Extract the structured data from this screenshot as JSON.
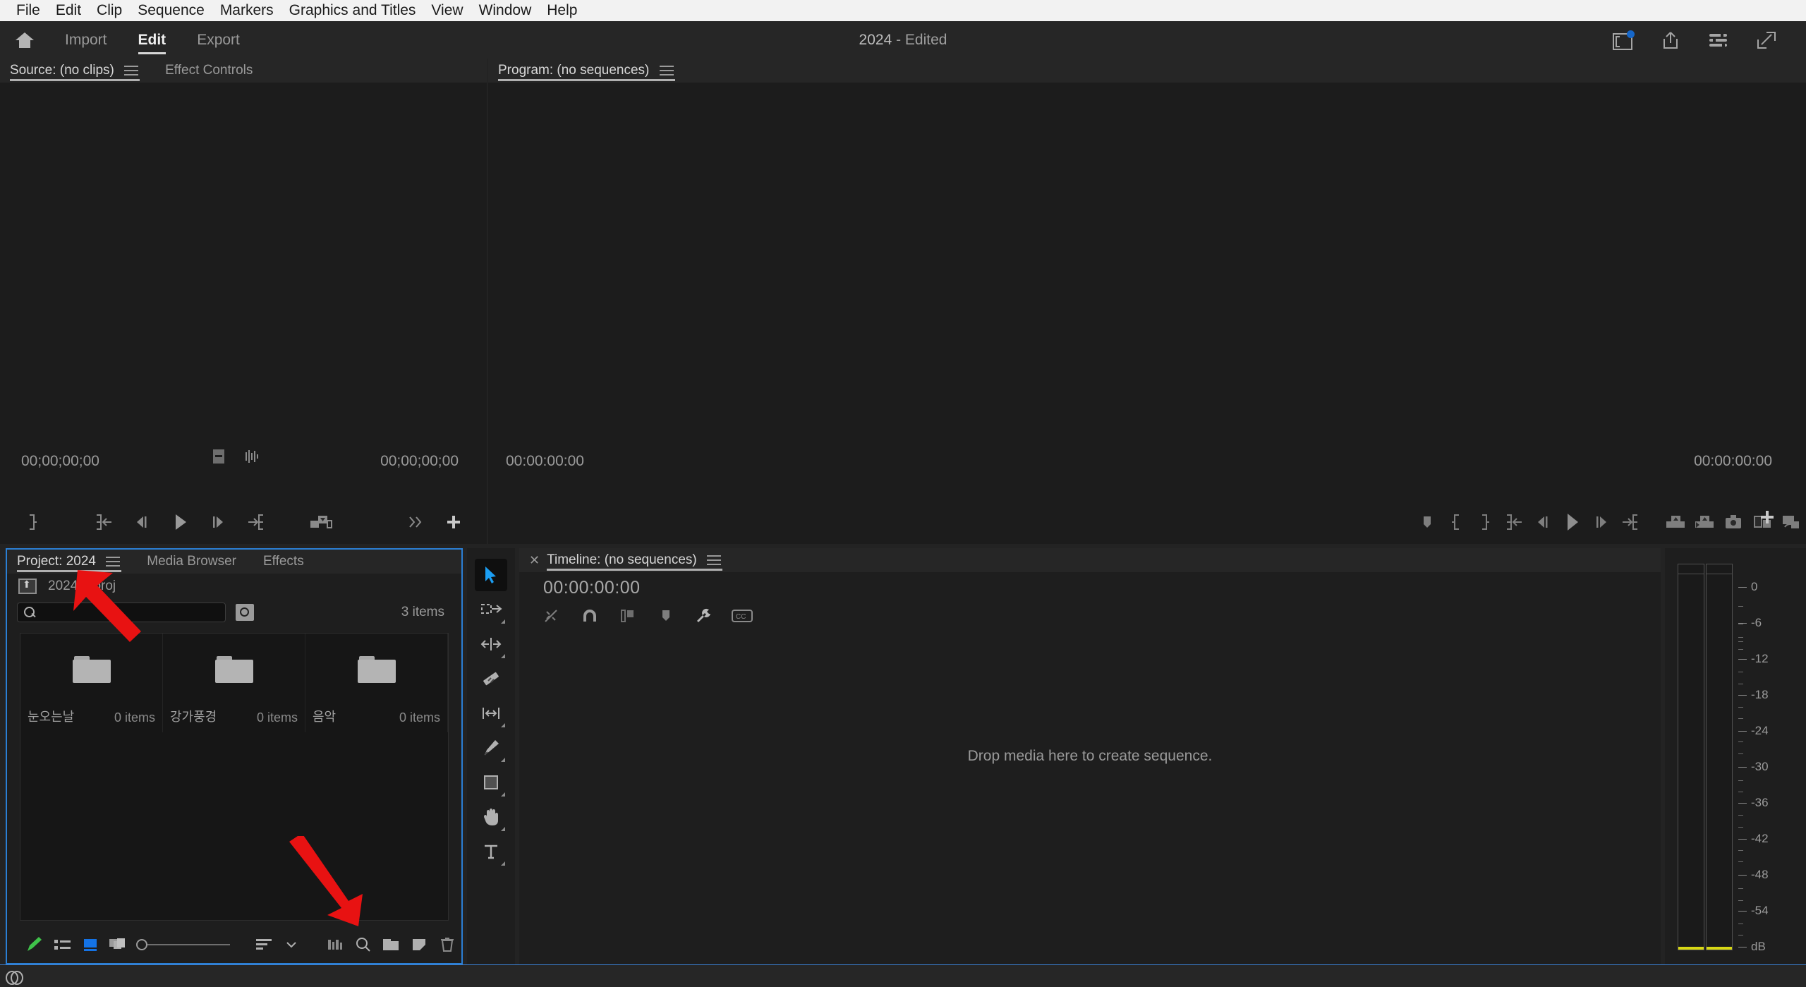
{
  "os_menu": {
    "items": [
      "File",
      "Edit",
      "Clip",
      "Sequence",
      "Markers",
      "Graphics and Titles",
      "View",
      "Window",
      "Help"
    ]
  },
  "header": {
    "home_icon": "home-icon",
    "modes": [
      {
        "label": "Import",
        "active": false
      },
      {
        "label": "Edit",
        "active": true
      },
      {
        "label": "Export",
        "active": false
      }
    ],
    "title_project": "2024",
    "title_status": "- Edited",
    "right_icons": [
      "panel-toggle-icon",
      "share-icon",
      "settings-sliders-icon",
      "fullscreen-expand-icon"
    ]
  },
  "source_panel": {
    "tabs": [
      {
        "label": "Source: (no clips)",
        "active": true
      },
      {
        "label": "Effect Controls",
        "active": false
      }
    ],
    "timecode_left": "00;00;00;00",
    "timecode_right": "00;00;00;00",
    "transport_icons": [
      "mark-out",
      "go-to-in",
      "step-back",
      "play",
      "step-forward",
      "go-to-out",
      "insert-overwrite",
      "more-chevrons",
      "button-editor-plus"
    ],
    "mid_icons": [
      "settings-frame-icon",
      "audio-waveform-icon"
    ]
  },
  "program_panel": {
    "tabs": [
      {
        "label": "Program: (no sequences)",
        "active": true
      }
    ],
    "timecode_left": "00:00:00:00",
    "timecode_right": "00:00:00:00",
    "transport_icons": [
      "add-marker",
      "mark-in",
      "mark-out",
      "go-to-in",
      "step-back",
      "play",
      "step-forward",
      "go-to-out",
      "lift",
      "extract",
      "export-frame",
      "comparison-view",
      "multi-camera"
    ],
    "button_editor": "button-editor-plus"
  },
  "project_panel": {
    "tabs": [
      {
        "label": "Project: 2024",
        "active": true
      },
      {
        "label": "Media Browser",
        "active": false
      },
      {
        "label": "Effects",
        "active": false
      }
    ],
    "breadcrumb": "2024.prproj",
    "search": {
      "value": "",
      "placeholder": ""
    },
    "items_count": "3 items",
    "bins": [
      {
        "name": "눈오는날",
        "count": "0 items"
      },
      {
        "name": "강가풍경",
        "count": "0 items"
      },
      {
        "name": "음악",
        "count": "0 items"
      }
    ],
    "toolbar_icons": [
      "pen-highlight-icon",
      "list-view-icon",
      "icon-view-icon",
      "freeform-view-icon",
      "zoom-slider",
      "sort-icon",
      "chevron-down-icon",
      "filter-bins-icon",
      "find-icon",
      "new-bin-icon",
      "new-item-icon",
      "delete-icon"
    ],
    "accent_blue": "#2b7fd4",
    "accent_green": "#3fc24a"
  },
  "tools_panel": {
    "tools": [
      {
        "name": "selection-tool",
        "active": true
      },
      {
        "name": "track-select-forward-tool",
        "active": false
      },
      {
        "name": "ripple-edit-tool",
        "active": false
      },
      {
        "name": "razor-tool",
        "active": false
      },
      {
        "name": "slip-tool",
        "active": false
      },
      {
        "name": "pen-tool",
        "active": false
      },
      {
        "name": "rectangle-tool",
        "active": false
      },
      {
        "name": "hand-tool",
        "active": false
      },
      {
        "name": "type-tool",
        "active": false
      }
    ]
  },
  "timeline_panel": {
    "tab_label": "Timeline: (no sequences)",
    "timecode": "00:00:00:00",
    "drop_message": "Drop media here to create sequence.",
    "toolbar_icons": [
      "insert-overwrite-icon",
      "snap-icon",
      "linked-selection-icon",
      "add-marker-icon",
      "timeline-settings-icon",
      "captions-icon"
    ]
  },
  "audio_meters": {
    "labels": [
      "0",
      "-6",
      "-12",
      "-18",
      "-24",
      "-30",
      "-36",
      "-42",
      "-48",
      "-54",
      "dB"
    ],
    "meter_color": "#d8d814",
    "channels": 2
  },
  "status_bar": {
    "icon": "creative-cloud-icon"
  },
  "annotations": {
    "arrow_color": "#e81212",
    "arrows": [
      "project-tab-arrow",
      "bin-area-arrow"
    ]
  }
}
